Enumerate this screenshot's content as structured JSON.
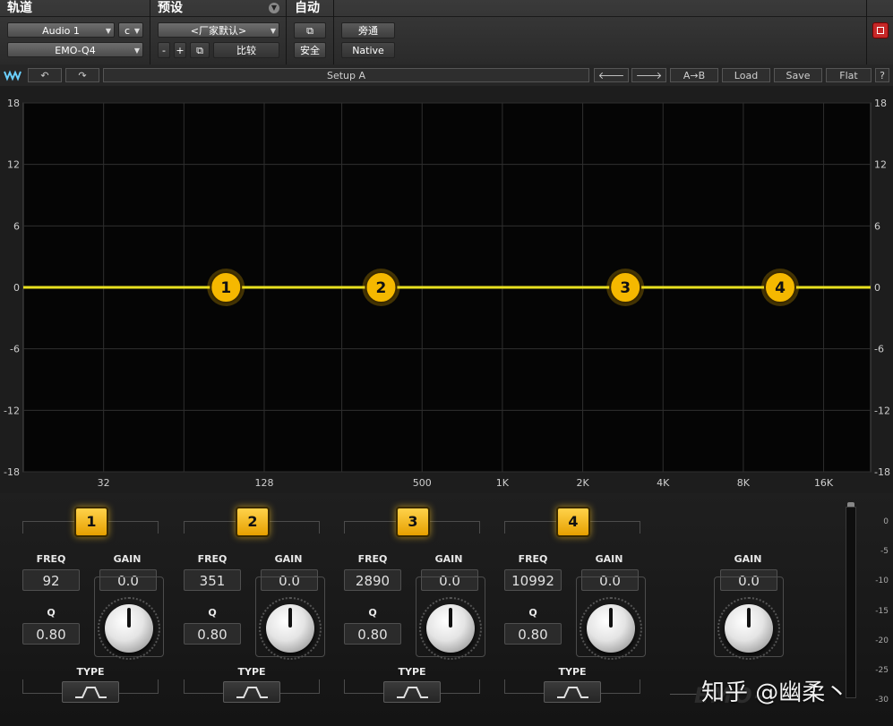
{
  "header": {
    "track": {
      "title": "轨道",
      "track_name": "Audio 1",
      "channel": "c",
      "plugin": "EMO-Q4"
    },
    "preset": {
      "title": "预设",
      "preset_name": "<厂家默认>",
      "minus": "-",
      "plus": "+",
      "compare": "比较"
    },
    "auto": {
      "title": "自动",
      "safe": "安全"
    },
    "bypass": "旁通",
    "native": "Native"
  },
  "toolbar": {
    "setup_name": "Setup A",
    "a_to_b": "A→B",
    "load": "Load",
    "save": "Save",
    "flat": "Flat",
    "help": "?"
  },
  "graph": {
    "y_ticks": [
      "18",
      "12",
      "6",
      "0",
      "-6",
      "-12",
      "-18"
    ],
    "x_ticks": [
      "32",
      "128",
      "500",
      "1K",
      "2K",
      "4K",
      "8K",
      "16K"
    ],
    "curve_color": "#e8e020",
    "node_color": "#f5b800",
    "nodes": [
      {
        "label": "1",
        "freq": 92,
        "gain": 0.0
      },
      {
        "label": "2",
        "freq": 351,
        "gain": 0.0
      },
      {
        "label": "3",
        "freq": 2890,
        "gain": 0.0
      },
      {
        "label": "4",
        "freq": 10992,
        "gain": 0.0
      }
    ]
  },
  "bands": [
    {
      "number": "1",
      "freq_label": "FREQ",
      "freq": "92",
      "gain_label": "GAIN",
      "gain": "0.0",
      "q_label": "Q",
      "q": "0.80",
      "type_label": "TYPE",
      "type_icon": "bell-filter-icon"
    },
    {
      "number": "2",
      "freq_label": "FREQ",
      "freq": "351",
      "gain_label": "GAIN",
      "gain": "0.0",
      "q_label": "Q",
      "q": "0.80",
      "type_label": "TYPE",
      "type_icon": "bell-filter-icon"
    },
    {
      "number": "3",
      "freq_label": "FREQ",
      "freq": "2890",
      "gain_label": "GAIN",
      "gain": "0.0",
      "q_label": "Q",
      "q": "0.80",
      "type_label": "TYPE",
      "type_icon": "bell-filter-icon"
    },
    {
      "number": "4",
      "freq_label": "FREQ",
      "freq": "10992",
      "gain_label": "GAIN",
      "gain": "0.0",
      "q_label": "Q",
      "q": "0.80",
      "type_label": "TYPE",
      "type_icon": "bell-filter-icon"
    }
  ],
  "output": {
    "gain_label": "GAIN",
    "gain": "0.0"
  },
  "meter": {
    "ticks": [
      "0",
      "-5",
      "-10",
      "-15",
      "-20",
      "-25",
      "-30"
    ]
  },
  "watermark": "知乎 @幽柔丶",
  "product_logo": "EMO-"
}
